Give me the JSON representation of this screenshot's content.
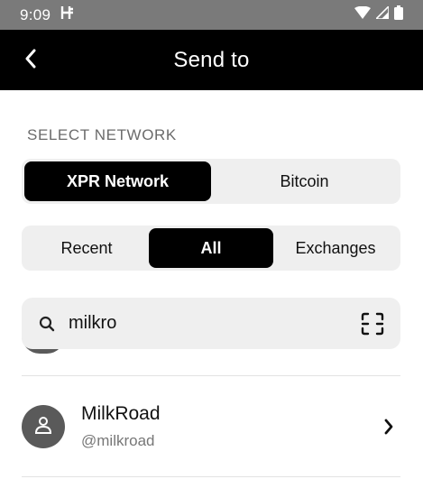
{
  "status_bar": {
    "time": "9:09",
    "icons": [
      "h-app-icon",
      "wifi-icon",
      "signal-icon",
      "battery-icon"
    ]
  },
  "app_bar": {
    "title": "Send to",
    "back_icon": "chevron-left-icon"
  },
  "network": {
    "label": "SELECT NETWORK",
    "options": [
      {
        "label": "XPR Network",
        "active": true
      },
      {
        "label": "Bitcoin",
        "active": false
      }
    ]
  },
  "filters": {
    "options": [
      {
        "label": "Recent",
        "active": false
      },
      {
        "label": "All",
        "active": true
      },
      {
        "label": "Exchanges",
        "active": false
      }
    ]
  },
  "search": {
    "value": "milkro",
    "icon": "search-icon",
    "scan_icon": "qr-scan-icon"
  },
  "contacts": [
    {
      "name": "MilkRoad",
      "handle": "@milkroad",
      "icon": "person-icon"
    }
  ],
  "colors": {
    "status_bar": "#7a7a7a",
    "app_bar": "#000000",
    "segment_bg": "#efefef",
    "segment_active": "#000000",
    "avatar": "#5a5a5a"
  }
}
